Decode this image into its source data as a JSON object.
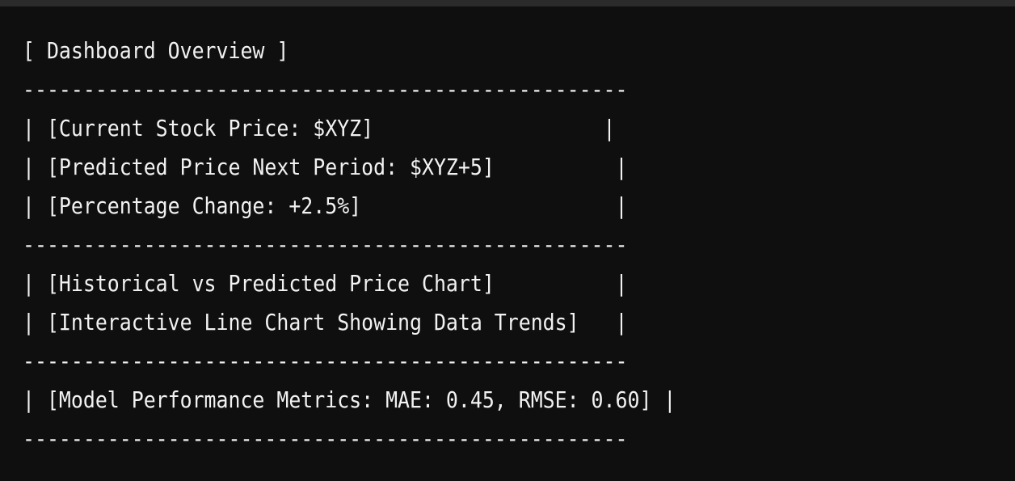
{
  "terminal": {
    "lines": [
      "[ Dashboard Overview ]",
      "--------------------------------------------------",
      "| [Current Stock Price: $XYZ]                   |",
      "| [Predicted Price Next Period: $XYZ+5]          |",
      "| [Percentage Change: +2.5%]                     |",
      "--------------------------------------------------",
      "| [Historical vs Predicted Price Chart]          |",
      "| [Interactive Line Chart Showing Data Trends]   |",
      "--------------------------------------------------",
      "| [Model Performance Metrics: MAE: 0.45, RMSE: 0.60] |",
      "--------------------------------------------------"
    ]
  }
}
